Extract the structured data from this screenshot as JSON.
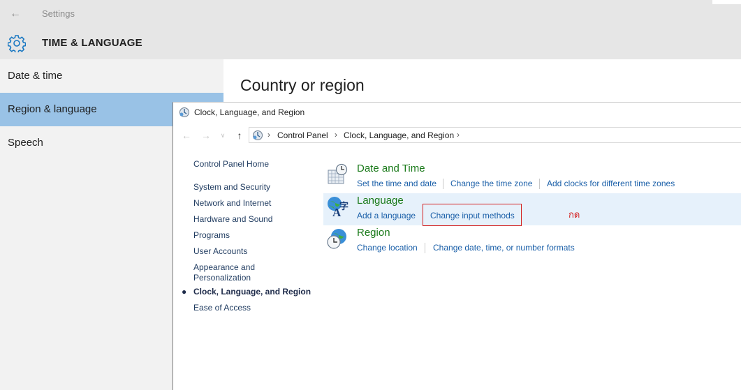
{
  "settings": {
    "window_title": "Settings",
    "header_title": "TIME & LANGUAGE",
    "sidebar": [
      {
        "label": "Date & time",
        "selected": false
      },
      {
        "label": "Region & language",
        "selected": true
      },
      {
        "label": "Speech",
        "selected": false
      }
    ],
    "main_heading": "Country or region"
  },
  "control_panel": {
    "window_title": "Clock, Language, and Region",
    "breadcrumb": [
      "Control Panel",
      "Clock, Language, and Region"
    ],
    "left_nav": {
      "home": "Control Panel Home",
      "items": [
        "System and Security",
        "Network and Internet",
        "Hardware and Sound",
        "Programs",
        "User Accounts",
        "Appearance and",
        "Personalization",
        "Clock, Language, and Region",
        "Ease of Access"
      ],
      "current_index": 7
    },
    "categories": [
      {
        "title": "Date and Time",
        "icon": "calendar-clock-icon",
        "links": [
          "Set the time and date",
          "Change the time zone",
          "Add clocks for different time zones"
        ]
      },
      {
        "title": "Language",
        "icon": "language-globe-icon",
        "links": [
          "Add a language",
          "Change input methods"
        ]
      },
      {
        "title": "Region",
        "icon": "globe-clock-icon",
        "links": [
          "Change location",
          "Change date, time, or number formats"
        ]
      }
    ],
    "annotation": "กด"
  },
  "colors": {
    "selected_sidebar": "#99c2e6",
    "category_title": "#1a7a1a",
    "link": "#1a5fa8",
    "highlight_row": "#e6f1fb",
    "annotation_red": "#d42020"
  }
}
